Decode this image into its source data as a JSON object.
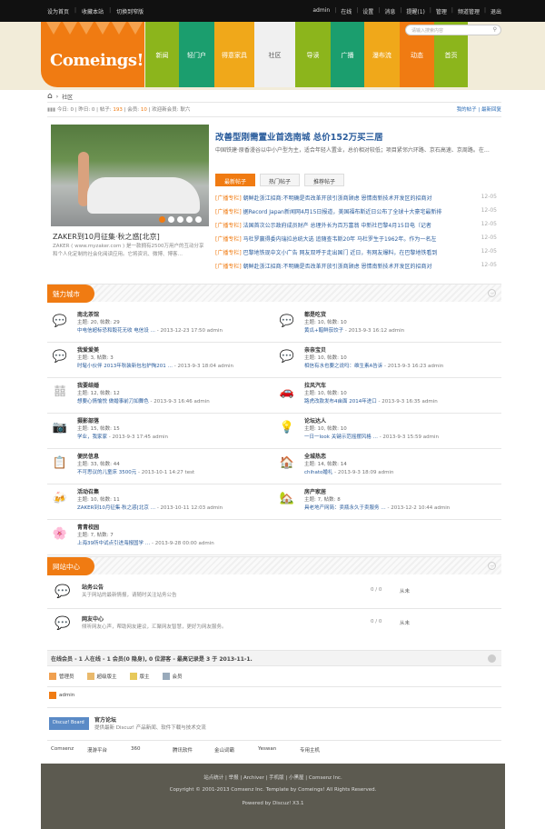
{
  "topbar": {
    "left": [
      "设为首页",
      "收藏本站",
      "切换到窄版"
    ],
    "right": [
      "admin",
      "在线",
      "设置",
      "消息",
      "提醒(1)",
      "管理",
      "频道管理",
      "退出"
    ]
  },
  "logo": {
    "text": "Comeings!"
  },
  "nav": [
    {
      "label": "新闻",
      "color": "#8cb51c"
    },
    {
      "label": "轻门户",
      "color": "#1b9e6e"
    },
    {
      "label": "得意家具",
      "color": "#f0a81a"
    },
    {
      "label": "社区",
      "color": "#f0f0f0",
      "text": "#555"
    },
    {
      "label": "导读",
      "color": "#8cb51c"
    },
    {
      "label": "广播",
      "color": "#1b9e6e"
    },
    {
      "label": "瀑布流",
      "color": "#f0a81a"
    },
    {
      "label": "动态",
      "color": "#f07b12"
    },
    {
      "label": "首页",
      "color": "#8cb51c"
    }
  ],
  "search": {
    "placeholder": "请输入搜索内容"
  },
  "breadcrumb": {
    "home": "⌂",
    "sep": "›",
    "current": "社区"
  },
  "stats": {
    "today": "今日: 0",
    "yesterday": "昨日: 0",
    "posts_l": "帖子: ",
    "posts_v": "193",
    "members_l": "会员: ",
    "members_v": "10",
    "newest": "欢迎新会员: 耿六",
    "my_posts": "我的帖子",
    "latest": "最新回复"
  },
  "feature": {
    "title": "ZAKER到10月征集·秋之惑[北京]",
    "desc": "ZAKER ( www.myzaker.com ) 是一款拥有2500万用户的互动分享和个人化定制的社会化阅读应用。它将资讯、微博、博客…"
  },
  "headline": {
    "title": "改善型刚需置业首选南城 总价152万买三居",
    "desc": "中国铁建·原香漫谷以中小户型为主，适合年轻人置业，总价相对较低；项目紧邻六环路、京石高速、京周路。在…"
  },
  "tabs": [
    "最新帖子",
    "热门帖子",
    "推荐帖子"
  ],
  "news": [
    {
      "tag": "[广播专栏]",
      "title": "朝鲜赴浙江招商:不明确是否改革开放引浙商顾虑 恩情南新技术开发区的招商对",
      "date": "12-05"
    },
    {
      "tag": "[广播专栏]",
      "title": "据Record Japan新闻网4月15日报道，美国福布斯近日公布了全球十大豪宅最新排",
      "date": "12-05"
    },
    {
      "tag": "[广播专栏]",
      "title": "法国首次公示政府成员财产 总理外长为百万富翁 中新社巴黎4月15日电（记者 ",
      "date": "12-05"
    },
    {
      "tag": "[广播专栏]",
      "title": "马杜罗赢得委内瑞拉总统大选 追随查韦斯20年 马杜罗生于1962年。作为一名左",
      "date": "12-05"
    },
    {
      "tag": "[广播专栏]",
      "title": "巴黎地铁现中文小广告 网友双呼于走出国门 近日，有网友爆料，在巴黎地铁看到",
      "date": "12-05"
    },
    {
      "tag": "[广播专栏]",
      "title": "朝鲜赴浙江招商:不明确是否改革开放引浙商顾虑 恩情南新技术开发区的招商对",
      "date": "12-05"
    }
  ],
  "section1": "魅力城市",
  "forums": [
    {
      "name": "南北茶馆",
      "stat": "主题: 20, 帖数: 29",
      "link": "中电信超标恐和毅花无收 电信设 …",
      "time": " - 2013-12-23 17:50 admin",
      "icon": "💬"
    },
    {
      "name": "都是吃货",
      "stat": "主题: 10, 帖数: 10",
      "link": "黄瓜+醋鲜茄饺子",
      "time": " - 2013-9-3 16:12 admin",
      "icon": "💬"
    },
    {
      "name": "我爱爱美",
      "stat": "主题: 3, 帖数: 3",
      "link": "时髦小伙伴 2013年秋装新包包护掏201 …",
      "time": " - 2013-9-3 18:04 admin",
      "icon": "💬"
    },
    {
      "name": "亲亲宝贝",
      "stat": "主题: 10, 帖数: 10",
      "link": "相信有水也要之说吗：维生素A告诉",
      "time": " - 2013-9-3 16:23 admin",
      "icon": "💬"
    },
    {
      "name": "我要结婚",
      "stat": "主题: 12, 帖数: 12",
      "link": "想要心情愉悦  做婚事前刀如舞色",
      "time": " - 2013-9-3 16:46 admin",
      "icon": "囍"
    },
    {
      "name": "拉风汽车",
      "stat": "主题: 10, 帖数: 10",
      "link": "路虎改款发布4亩面 2014年进口",
      "time": " - 2013-9-3 16:35 admin",
      "icon": "🚗"
    },
    {
      "name": "摄影部落",
      "stat": "主题: 15, 帖数: 15",
      "link": "学业，我家家",
      "time": " - 2013-9-3 17:45 admin",
      "icon": "📷"
    },
    {
      "name": "论坛达人",
      "stat": "主题: 10, 帖数: 10",
      "link": "一日一look 关键示范摇摆风格 …",
      "time": " - 2013-9-3 15:59 admin",
      "icon": "💡"
    },
    {
      "name": "便民信息",
      "stat": "主题: 33, 帖数: 44",
      "link": "不可思议的儿童床 3500元",
      "time": " - 2013-10-1 14:27 test",
      "icon": "📋"
    },
    {
      "name": "全城热恋",
      "stat": "主题: 14, 帖数: 14",
      "link": "chihato婚礼",
      "time": " - 2013-9-3 18:09 admin",
      "icon": "🏠"
    },
    {
      "name": "活动召集",
      "stat": "主题: 10, 帖数: 11",
      "link": "ZAKER到10月征集·秋之惑[北京 …",
      "time": " - 2013-10-11 12:03 admin",
      "icon": "🍻"
    },
    {
      "name": "房产家居",
      "stat": "主题: 7, 帖数: 8",
      "link": "具老地产网简：卖瓶永久于卖服务 …",
      "time": " - 2013-12-2 10:44 admin",
      "icon": "🏡"
    },
    {
      "name": "青青校园",
      "stat": "主题: 7, 帖数: 7",
      "link": "上海39所中试点引进海报国学 …",
      "time": " - 2013-9-28 00:00 admin",
      "icon": "🌸"
    }
  ],
  "section2": "网站中心",
  "site_forums": [
    {
      "name": "站务公告",
      "desc": "关于网站的最新情报，请随时关注站务公告",
      "count": "0 / 0",
      "from": "从未"
    },
    {
      "name": "网友中心",
      "desc": "倾听网友心声，帮助网友建议，汇聚网友智慧，更好为网友服务。",
      "count": "0 / 0",
      "from": "从未"
    }
  ],
  "online": {
    "text": "在线会员 - 1 人在线 - 1 会员(0 隐身), 0 位游客 - 最高记录是 3 于 2013-11-1."
  },
  "legend": [
    "管理员",
    "超级版主",
    "版主",
    "会员"
  ],
  "user": "admin",
  "friend_link": {
    "badge": "Discuz! Board",
    "name": "官方论坛",
    "desc": "提供最新 Discuz! 产品新闻、软件下载与技术交流"
  },
  "links": [
    "Comsenz",
    "漫游平台",
    "360",
    "腾讯软件",
    "金山词霸",
    "Yeswan",
    "专用主机"
  ],
  "footer": {
    "l1": "站点统计 | 举报 | Archiver | 手机版 | 小黑屋 | Comsenz Inc.",
    "l2": "Copyright © 2001-2013 Comsenz Inc.  Template by Comeings! All Rights Reserved.",
    "l3": "Powered by Discuz! X3.1"
  }
}
